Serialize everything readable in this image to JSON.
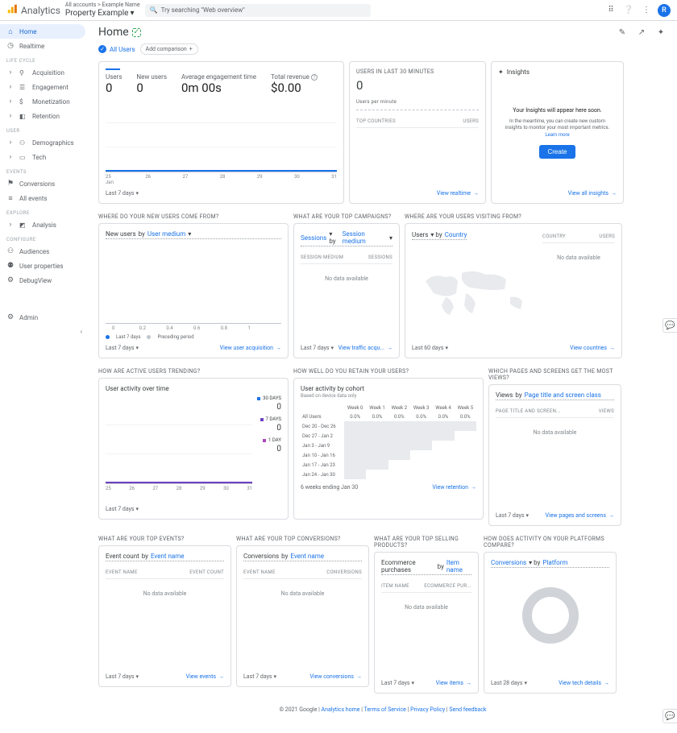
{
  "header": {
    "product": "Analytics",
    "account_path": "All accounts > Example Name",
    "property": "Property Example",
    "search_placeholder": "Try searching \"Web overview\"",
    "avatar_letter": "R"
  },
  "sidebar": {
    "items_primary": [
      {
        "icon": "⌂",
        "label": "Home",
        "active": true
      },
      {
        "icon": "◷",
        "label": "Realtime"
      }
    ],
    "sections": [
      {
        "title": "Life Cycle",
        "items": [
          {
            "icon": "›",
            "label": "Acquisition"
          },
          {
            "icon": "›",
            "label": "Engagement"
          },
          {
            "icon": "›",
            "label": "Monetization"
          },
          {
            "icon": "›",
            "label": "Retention"
          }
        ]
      },
      {
        "title": "User",
        "items": [
          {
            "icon": "›",
            "label": "Demographics"
          },
          {
            "icon": "›",
            "label": "Tech"
          }
        ]
      },
      {
        "title": "Events",
        "items": [
          {
            "icon": "⚑",
            "label": "Conversions"
          },
          {
            "icon": "≡",
            "label": "All events"
          }
        ]
      },
      {
        "title": "Explore",
        "items": [
          {
            "icon": "›",
            "label": "Analysis"
          }
        ]
      },
      {
        "title": "Configure",
        "items": [
          {
            "icon": "⚇",
            "label": "Audiences"
          },
          {
            "icon": "⚉",
            "label": "User properties"
          },
          {
            "icon": "⚙",
            "label": "DebugView"
          }
        ]
      }
    ],
    "admin": {
      "icon": "⚙",
      "label": "Admin"
    }
  },
  "page": {
    "title": "Home",
    "all_users": "All Users",
    "add_comparison": "Add comparison"
  },
  "overview": {
    "metrics": [
      {
        "label": "Users",
        "value": "0"
      },
      {
        "label": "New users",
        "value": "0"
      },
      {
        "label": "Average engagement time",
        "value": "0m 00s"
      },
      {
        "label": "Total revenue",
        "value": "$0.00",
        "info": true
      }
    ],
    "xaxis": [
      "25",
      "26",
      "27",
      "28",
      "29",
      "30",
      "31"
    ],
    "xsub": "Jan",
    "date_range": "Last 7 days"
  },
  "realtime": {
    "title": "Users in last 30 minutes",
    "value": "0",
    "sub": "Users per minute",
    "th_country": "Top countries",
    "th_users": "Users",
    "link": "View realtime"
  },
  "insights": {
    "title": "Insights",
    "headline": "Your Insights will appear here soon.",
    "body": "In the meantime, you can create new custom insights to monitor your most important metrics.",
    "learn": "Learn more",
    "create": "Create",
    "link": "View all insights"
  },
  "acquisition": {
    "section": "Where do your new users come from?",
    "control_metric": "New users",
    "control_dim": "User medium",
    "xaxis": [
      "0",
      "0.2",
      "0.4",
      "0.6",
      "0.8",
      "1"
    ],
    "legend_a": "Last 7 days",
    "legend_b": "Preceding period",
    "date_range": "Last 7 days",
    "link": "View user acquisition"
  },
  "campaigns": {
    "section": "What are your top campaigns?",
    "control_metric": "Sessions",
    "control_dim": "Session medium",
    "th1": "Session medium",
    "th2": "Sessions",
    "no_data": "No data available",
    "date_range": "Last 7 days",
    "link": "View traffic acqu..."
  },
  "geo": {
    "section": "Where are your users visiting from?",
    "control_metric": "Users",
    "control_dim": "Country",
    "th1": "Country",
    "th2": "Users",
    "no_data": "No data available",
    "date_range": "Last 60 days",
    "link": "View countries"
  },
  "trending": {
    "section": "How are active users trending?",
    "title": "User activity over time",
    "legend": [
      {
        "label": "30 DAYS",
        "value": "0",
        "color": "#1a73e8"
      },
      {
        "label": "7 DAYS",
        "value": "0",
        "color": "#6f42c1"
      },
      {
        "label": "1 DAY",
        "value": "0",
        "color": "#ab47bc"
      }
    ],
    "xaxis": [
      "25",
      "26",
      "27",
      "28",
      "29",
      "30",
      "31"
    ],
    "date_range": "Last 7 days"
  },
  "retention": {
    "section": "How well do you retain your users?",
    "title": "User activity by cohort",
    "sub": "Based on device data only",
    "weeks": [
      "Week 0",
      "Week 1",
      "Week 2",
      "Week 3",
      "Week 4",
      "Week 5"
    ],
    "all_users": "All Users",
    "pct": "0.0%",
    "rows": [
      "Dec 20 - Dec 26",
      "Dec 27 - Jan 2",
      "Jan 3 - Jan 9",
      "Jan 10 - Jan 16",
      "Jan 17 - Jan 23",
      "Jan 24 - Jan 30"
    ],
    "footer": "6 weeks ending Jan 30",
    "link": "View retention"
  },
  "pages": {
    "section": "Which pages and screens get the most views?",
    "control_metric": "Views",
    "control_dim": "Page title and screen class",
    "th1": "Page title and screen...",
    "th2": "Views",
    "no_data": "No data available",
    "date_range": "Last 7 days",
    "link": "View pages and screens"
  },
  "events": {
    "section": "What are your top events?",
    "control_metric": "Event count",
    "control_dim": "Event name",
    "th1": "Event name",
    "th2": "Event count",
    "no_data": "No data available",
    "date_range": "Last 7 days",
    "link": "View events"
  },
  "conversions": {
    "section": "What are your top conversions?",
    "control_metric": "Conversions",
    "control_dim": "Event name",
    "th1": "Event name",
    "th2": "Conversions",
    "no_data": "No data available",
    "date_range": "Last 7 days",
    "link": "View conversions"
  },
  "ecommerce": {
    "section": "What are your top selling products?",
    "control_metric": "Ecommerce purchases",
    "control_dim": "Item name",
    "th1": "Item name",
    "th2": "Ecommerce pur...",
    "no_data": "No data available",
    "date_range": "Last 7 days",
    "link": "View items"
  },
  "platform": {
    "section": "How does activity on your platforms compare?",
    "control_metric": "Conversions",
    "control_dim": "Platform",
    "date_range": "Last 28 days",
    "link": "View tech details"
  },
  "footer": {
    "copyright": "© 2021 Google",
    "links": [
      "Analytics home",
      "Terms of Service",
      "Privacy Policy",
      "Send feedback"
    ]
  },
  "chart_data": [
    {
      "type": "line",
      "title": "Overview metrics over time",
      "x": [
        25,
        26,
        27,
        28,
        29,
        30,
        31
      ],
      "series": [
        {
          "name": "Users",
          "values": [
            0,
            0,
            0,
            0,
            0,
            0,
            0
          ]
        }
      ],
      "ylim": [
        0,
        1
      ]
    },
    {
      "type": "bar",
      "title": "New users by User medium",
      "categories": [],
      "series": [
        {
          "name": "Last 7 days",
          "values": []
        },
        {
          "name": "Preceding period",
          "values": []
        }
      ],
      "xlim": [
        0,
        1
      ]
    },
    {
      "type": "line",
      "title": "User activity over time",
      "x": [
        25,
        26,
        27,
        28,
        29,
        30,
        31
      ],
      "series": [
        {
          "name": "30 DAYS",
          "values": [
            0,
            0,
            0,
            0,
            0,
            0,
            0
          ]
        },
        {
          "name": "7 DAYS",
          "values": [
            0,
            0,
            0,
            0,
            0,
            0,
            0
          ]
        },
        {
          "name": "1 DAY",
          "values": [
            0,
            0,
            0,
            0,
            0,
            0,
            0
          ]
        }
      ],
      "ylim": [
        0,
        1
      ]
    },
    {
      "type": "heatmap",
      "title": "User activity by cohort",
      "columns": [
        "Week 0",
        "Week 1",
        "Week 2",
        "Week 3",
        "Week 4",
        "Week 5"
      ],
      "rows": [
        "Dec 20 - Dec 26",
        "Dec 27 - Jan 2",
        "Jan 3 - Jan 9",
        "Jan 10 - Jan 16",
        "Jan 17 - Jan 23",
        "Jan 24 - Jan 30"
      ],
      "values": [
        [
          0,
          0,
          0,
          0,
          0,
          0
        ],
        [
          0,
          0,
          0,
          0,
          0,
          0
        ],
        [
          0,
          0,
          0,
          0,
          0,
          0
        ],
        [
          0,
          0,
          0,
          0,
          0,
          0
        ],
        [
          0,
          0,
          0,
          0,
          0,
          0
        ],
        [
          0,
          0,
          0,
          0,
          0,
          0
        ]
      ]
    },
    {
      "type": "pie",
      "title": "Conversions by Platform",
      "categories": [],
      "values": []
    }
  ]
}
